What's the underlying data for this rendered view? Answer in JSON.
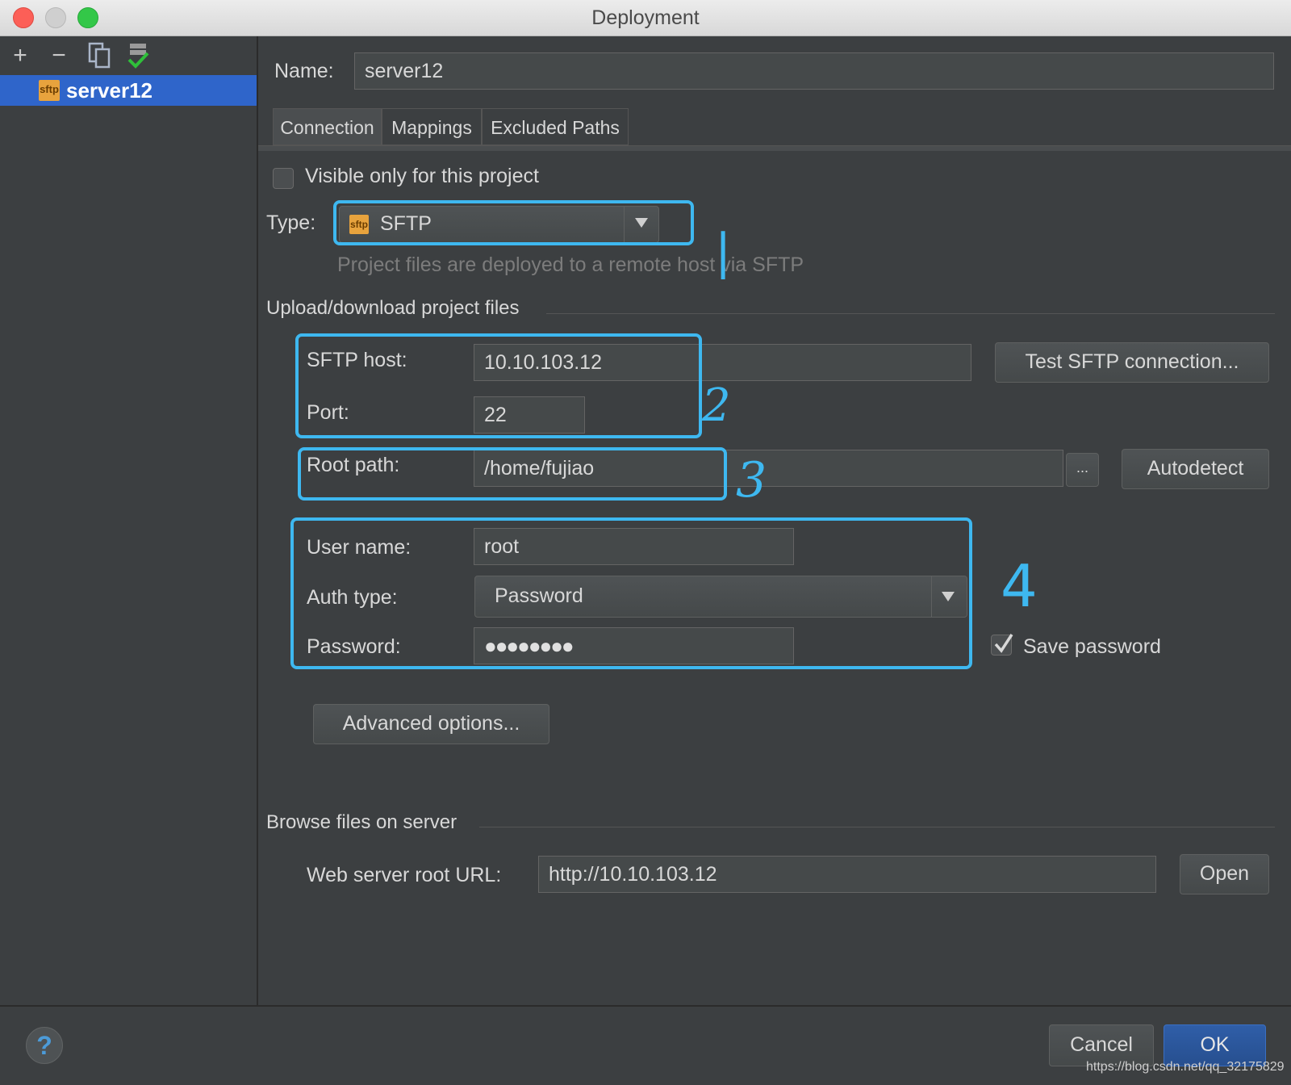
{
  "window": {
    "title": "Deployment"
  },
  "toolbar": {
    "add": "+",
    "remove": "−"
  },
  "servers": [
    {
      "name": "server12",
      "badge": "sftp"
    }
  ],
  "form": {
    "name_label": "Name:",
    "name_value": "server12",
    "tabs": [
      {
        "label": "Connection",
        "active": true
      },
      {
        "label": "Mappings",
        "active": false
      },
      {
        "label": "Excluded Paths",
        "active": false
      }
    ],
    "visible_only_label": "Visible only for this project",
    "visible_only_checked": false,
    "type_label": "Type:",
    "type_value": "SFTP",
    "type_badge": "sftp",
    "type_hint": "Project files are deployed to a remote host via SFTP",
    "upload_section": "Upload/download project files",
    "host_label": "SFTP host:",
    "host_value": "10.10.103.12",
    "test_button": "Test SFTP connection...",
    "port_label": "Port:",
    "port_value": "22",
    "root_label": "Root path:",
    "root_value": "/home/fujiao",
    "browse_button": "...",
    "autodetect_button": "Autodetect",
    "user_label": "User name:",
    "user_value": "root",
    "auth_label": "Auth type:",
    "auth_value": "Password",
    "password_label": "Password:",
    "password_value": "●●●●●●●●",
    "save_password_label": "Save password",
    "save_password_checked": true,
    "advanced_button": "Advanced options...",
    "browse_section": "Browse files on server",
    "web_url_label": "Web server root URL:",
    "web_url_value": "http://10.10.103.12",
    "open_button": "Open"
  },
  "annotations": [
    "|",
    "2",
    "3",
    "4"
  ],
  "footer": {
    "help": "?",
    "cancel_button": "Cancel",
    "ok_button": "OK",
    "watermark": "https://blog.csdn.net/qq_32175829"
  },
  "colors": {
    "accent": "#2f65ca",
    "highlight": "#3eb8f0",
    "panel": "#3c3f41"
  }
}
